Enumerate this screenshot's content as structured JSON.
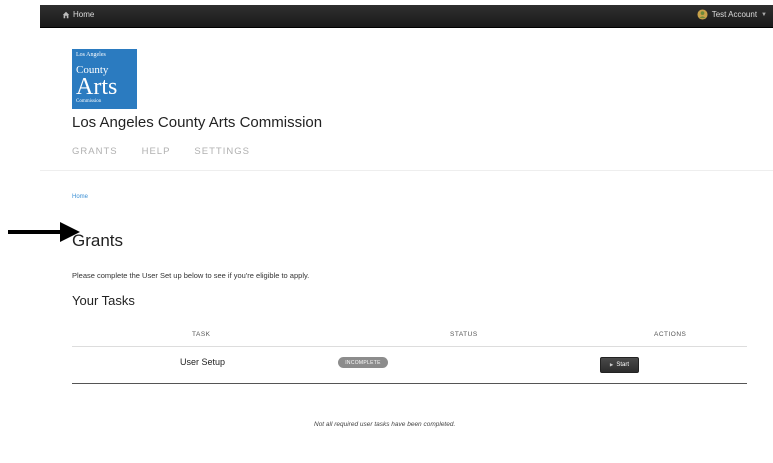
{
  "topbar": {
    "home_label": "Home",
    "account_label": "Test Account"
  },
  "logo": {
    "line1": "Los Angeles",
    "line2": "County",
    "line3": "Arts",
    "line4": "Commission"
  },
  "site_title": "Los Angeles County Arts Commission",
  "nav": {
    "items": [
      "GRANTS",
      "HELP",
      "SETTINGS"
    ]
  },
  "breadcrumb": "Home",
  "page_title": "Grants",
  "intro": "Please complete the User Set up below to see if you're eligible to apply.",
  "tasks": {
    "heading": "Your Tasks",
    "columns": [
      "TASK",
      "STATUS",
      "ACTIONS"
    ],
    "rows": [
      {
        "task": "User Setup",
        "status": "INCOMPLETE",
        "action": "Start"
      }
    ]
  },
  "note": "Not all required user tasks have been completed.",
  "colors": {
    "topbar": "#1f1f1f",
    "logo_bg": "#2b7bc0",
    "link": "#3a8fd4",
    "badge": "#8c8c8c"
  }
}
